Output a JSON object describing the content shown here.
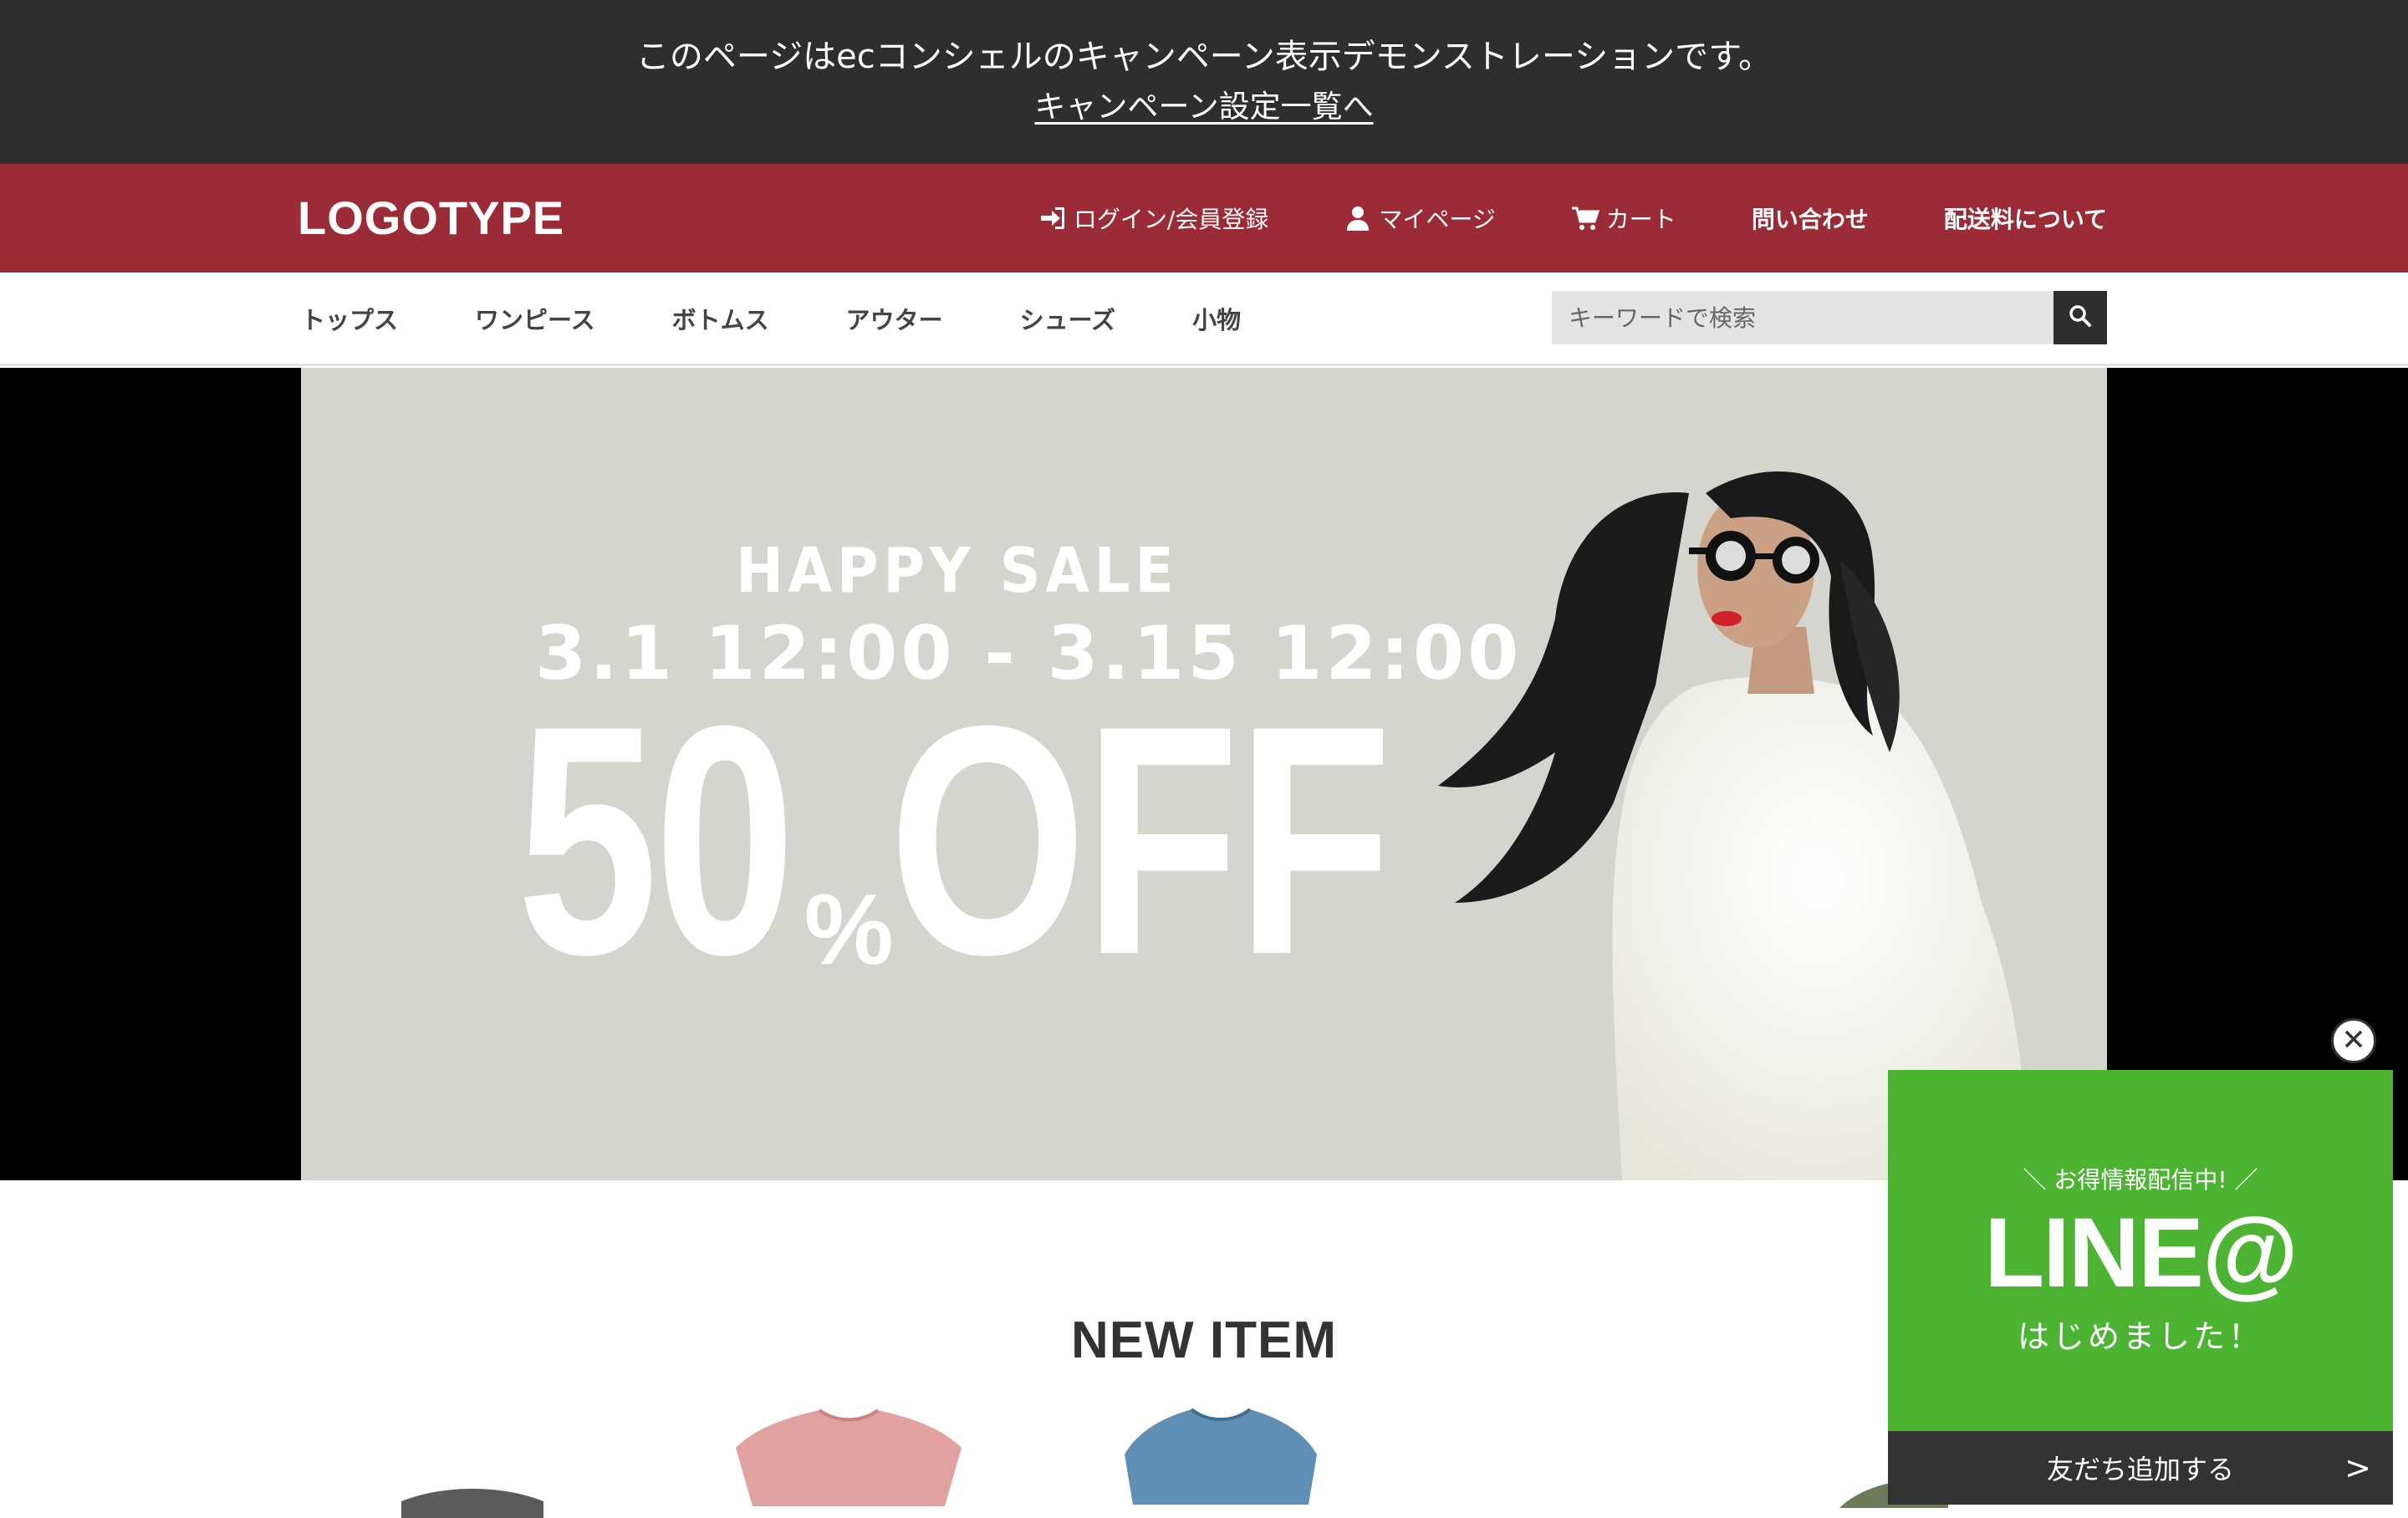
{
  "demo_bar": {
    "message": "このページはecコンシェルのキャンペーン表示デモンストレーションです。",
    "link": "キャンペーン設定一覧へ"
  },
  "header": {
    "logo": "LOGOTYPE",
    "nav": [
      {
        "label": "ログイン/会員登録",
        "icon": "login-icon"
      },
      {
        "label": "マイページ",
        "icon": "user-icon"
      },
      {
        "label": "カート",
        "icon": "cart-icon"
      },
      {
        "label": "問い合わせ"
      },
      {
        "label": "配送料について"
      }
    ]
  },
  "categories": [
    "トップス",
    "ワンピース",
    "ボトムス",
    "アウター",
    "シューズ",
    "小物"
  ],
  "search": {
    "placeholder": "キーワードで検索",
    "icon": "search-icon"
  },
  "hero": {
    "title": "HAPPY SALE",
    "period": "3.1 12:00 - 3.15 12:00",
    "discount_number": "50",
    "discount_percent": "%",
    "discount_word": "OFF"
  },
  "new_item": {
    "title": "NEW ITEM"
  },
  "line_popup": {
    "tagline": "＼ お得情報配信中! ／",
    "brand": "LINE@",
    "subtitle": "はじめました！",
    "cta": "友だち追加する",
    "cta_arrow": ">"
  },
  "colors": {
    "demo_bar": "#2e2e2e",
    "header": "#9c2b38",
    "banner_bg": "#d4d5cf",
    "line_green": "#4db433"
  }
}
